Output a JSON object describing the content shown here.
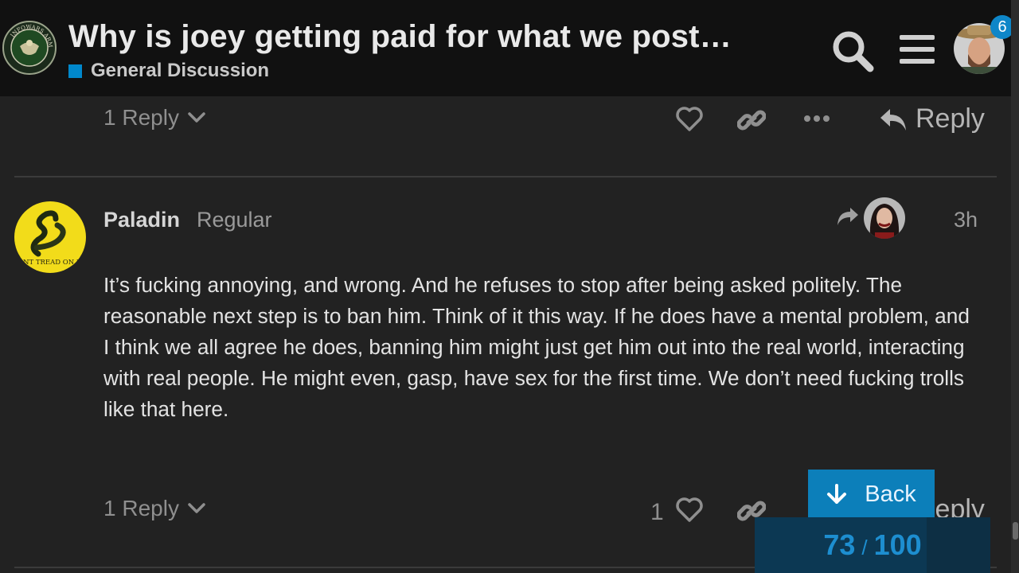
{
  "header": {
    "title": "Why is joey getting paid for what we post…",
    "category": "General Discussion",
    "category_color": "#0088cc",
    "logo_text": "INFOWARS ARMY",
    "notification_count": "6"
  },
  "previous_post": {
    "replies_label": "1 Reply",
    "reply_label": "Reply"
  },
  "post": {
    "username": "Paladin",
    "user_title": "Regular",
    "date": "3h",
    "avatar_text": "DONT TREAD ON ME",
    "body": "It’s fucking annoying, and wrong. And he refuses to stop after being asked politely. The reasonable next step is to ban him. Think of it this way. If he does have a mental problem, and I think we all agree he does, banning him might just get him out into the real world, interacting with real people. He might even, gasp, have sex for the first time. We don’t need fucking trolls like that here.",
    "replies_label": "1 Reply",
    "like_count": "1",
    "reply_label": "Reply"
  },
  "timeline": {
    "back_label": "Back",
    "current": "73",
    "total": "100",
    "separator": "/",
    "progress": 0.73
  },
  "icons": {
    "search": "search-icon",
    "menu": "hamburger-icon",
    "like": "heart-icon",
    "link": "link-icon",
    "more": "ellipsis-icon",
    "reply": "reply-arrow-icon",
    "back": "arrow-down-icon"
  },
  "colors": {
    "accent": "#0088cc",
    "background": "#222222",
    "header": "#111111"
  }
}
